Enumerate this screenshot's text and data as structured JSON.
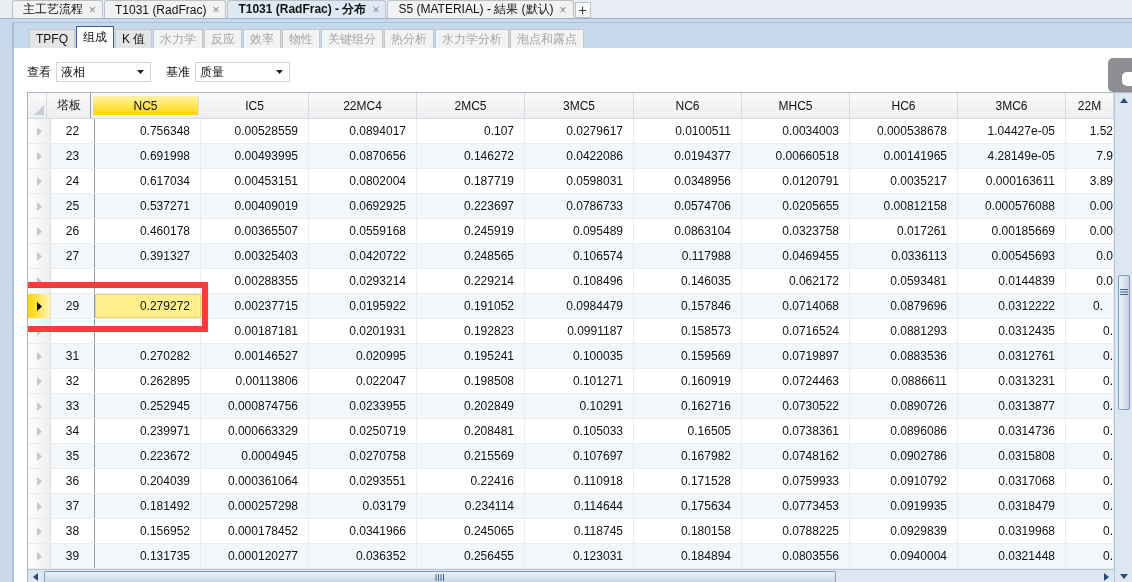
{
  "document_tabs": [
    {
      "label": "主工艺流程",
      "close": "×",
      "selected": false
    },
    {
      "label": "T1031 (RadFrac)",
      "close": "×",
      "selected": false
    },
    {
      "label": "T1031 (RadFrac) - 分布",
      "close": "×",
      "selected": true
    },
    {
      "label": "S5 (MATERIAL) - 結果 (默认)",
      "close": "×",
      "selected": false
    }
  ],
  "add_tab": "+",
  "tabs": [
    {
      "label": "TPFQ",
      "selected": false,
      "disabled": false
    },
    {
      "label": "组成",
      "selected": true,
      "disabled": false
    },
    {
      "label": "K 值",
      "selected": false,
      "disabled": false
    },
    {
      "label": "水力学",
      "selected": false,
      "disabled": true
    },
    {
      "label": "反应",
      "selected": false,
      "disabled": true
    },
    {
      "label": "效率",
      "selected": false,
      "disabled": true
    },
    {
      "label": "物性",
      "selected": false,
      "disabled": true
    },
    {
      "label": "关键组分",
      "selected": false,
      "disabled": true
    },
    {
      "label": "热分析",
      "selected": false,
      "disabled": true
    },
    {
      "label": "水力学分析",
      "selected": false,
      "disabled": true
    },
    {
      "label": "泡点和露点",
      "selected": false,
      "disabled": true
    }
  ],
  "filters": [
    {
      "label": "查看",
      "value": "液相"
    },
    {
      "label": "基准",
      "value": "质量"
    }
  ],
  "table": {
    "columns": [
      {
        "label": "塔板",
        "selected": false
      },
      {
        "label": "NC5",
        "selected": true
      },
      {
        "label": "IC5",
        "selected": false
      },
      {
        "label": "22MC4",
        "selected": false
      },
      {
        "label": "2MC5",
        "selected": false
      },
      {
        "label": "3MC5",
        "selected": false
      },
      {
        "label": "NC6",
        "selected": false
      },
      {
        "label": "MHC5",
        "selected": false
      },
      {
        "label": "HC6",
        "selected": false
      },
      {
        "label": "3MC6",
        "selected": false
      },
      {
        "label": "22M",
        "selected": false
      }
    ],
    "rows": [
      {
        "selected": false,
        "cells": [
          "22",
          "0.756348",
          "0.00528559",
          "0.0894017",
          "0.107",
          "0.0279617",
          "0.0100511",
          "0.0034003",
          "0.000538678",
          "1.04427e-05",
          "1.52"
        ]
      },
      {
        "selected": false,
        "cells": [
          "23",
          "0.691998",
          "0.00493995",
          "0.0870656",
          "0.146272",
          "0.0422086",
          "0.0194377",
          "0.00660518",
          "0.00141965",
          "4.28149e-05",
          "7.9"
        ]
      },
      {
        "selected": false,
        "cells": [
          "24",
          "0.617034",
          "0.00453151",
          "0.0802004",
          "0.187719",
          "0.0598031",
          "0.0348956",
          "0.0120791",
          "0.0035217",
          "0.000163611",
          "3.89"
        ]
      },
      {
        "selected": false,
        "cells": [
          "25",
          "0.537271",
          "0.00409019",
          "0.0692925",
          "0.223697",
          "0.0786733",
          "0.0574706",
          "0.0205655",
          "0.00812158",
          "0.000576088",
          "0.00"
        ]
      },
      {
        "selected": false,
        "cells": [
          "26",
          "0.460178",
          "0.00365507",
          "0.0559168",
          "0.245919",
          "0.095489",
          "0.0863104",
          "0.0323758",
          "0.017261",
          "0.00185669",
          "0.00"
        ]
      },
      {
        "selected": false,
        "cells": [
          "27",
          "0.391327",
          "0.00325403",
          "0.0420722",
          "0.248565",
          "0.106574",
          "0.117988",
          "0.0469455",
          "0.0336113",
          "0.00545693",
          "0.0"
        ]
      },
      {
        "selected": false,
        "cells": [
          null,
          null,
          "0.00288355",
          "0.0293214",
          "0.229214",
          "0.108496",
          "0.146035",
          "0.062172",
          "0.0593481",
          "0.0144839",
          "0.0"
        ]
      },
      {
        "selected": true,
        "cells": [
          "29",
          "0.279272",
          "0.00237715",
          "0.0195922",
          "0.191052",
          "0.0984479",
          "0.157846",
          "0.0714068",
          "0.0879696",
          "0.0312222",
          "0."
        ]
      },
      {
        "selected": false,
        "cells": [
          null,
          null,
          "0.00187181",
          "0.0201931",
          "0.192823",
          "0.0991187",
          "0.158573",
          "0.0716524",
          "0.0881293",
          "0.0312435",
          "0."
        ]
      },
      {
        "selected": false,
        "cells": [
          "31",
          "0.270282",
          "0.00146527",
          "0.020995",
          "0.195241",
          "0.100035",
          "0.159569",
          "0.0719897",
          "0.0883536",
          "0.0312761",
          "0."
        ]
      },
      {
        "selected": false,
        "cells": [
          "32",
          "0.262895",
          "0.00113806",
          "0.022047",
          "0.198508",
          "0.101271",
          "0.160919",
          "0.0724463",
          "0.0886611",
          "0.0313231",
          "0."
        ]
      },
      {
        "selected": false,
        "cells": [
          "33",
          "0.252945",
          "0.000874756",
          "0.0233955",
          "0.202849",
          "0.10291",
          "0.162716",
          "0.0730522",
          "0.0890726",
          "0.0313877",
          "0."
        ]
      },
      {
        "selected": false,
        "cells": [
          "34",
          "0.239971",
          "0.000663329",
          "0.0250719",
          "0.208481",
          "0.105033",
          "0.16505",
          "0.0738361",
          "0.0896086",
          "0.0314736",
          "0."
        ]
      },
      {
        "selected": false,
        "cells": [
          "35",
          "0.223672",
          "0.0004945",
          "0.0270758",
          "0.215569",
          "0.107697",
          "0.167982",
          "0.0748162",
          "0.0902786",
          "0.0315808",
          "0."
        ]
      },
      {
        "selected": false,
        "cells": [
          "36",
          "0.204039",
          "0.000361064",
          "0.0293551",
          "0.22416",
          "0.110918",
          "0.171528",
          "0.0759933",
          "0.0910792",
          "0.0317068",
          "0."
        ]
      },
      {
        "selected": false,
        "cells": [
          "37",
          "0.181492",
          "0.000257298",
          "0.03179",
          "0.234114",
          "0.114644",
          "0.175634",
          "0.0773453",
          "0.0919935",
          "0.0318479",
          "0."
        ]
      },
      {
        "selected": false,
        "cells": [
          "38",
          "0.156952",
          "0.000178452",
          "0.0341966",
          "0.245065",
          "0.118745",
          "0.180158",
          "0.0788225",
          "0.0929839",
          "0.0319968",
          "0."
        ]
      },
      {
        "selected": false,
        "cells": [
          "39",
          "0.131735",
          "0.000120277",
          "0.036352",
          "0.256455",
          "0.123031",
          "0.184894",
          "0.0803556",
          "0.0940004",
          "0.0321448",
          "0."
        ]
      }
    ]
  },
  "annotation": {
    "kind": "highlight-box"
  }
}
